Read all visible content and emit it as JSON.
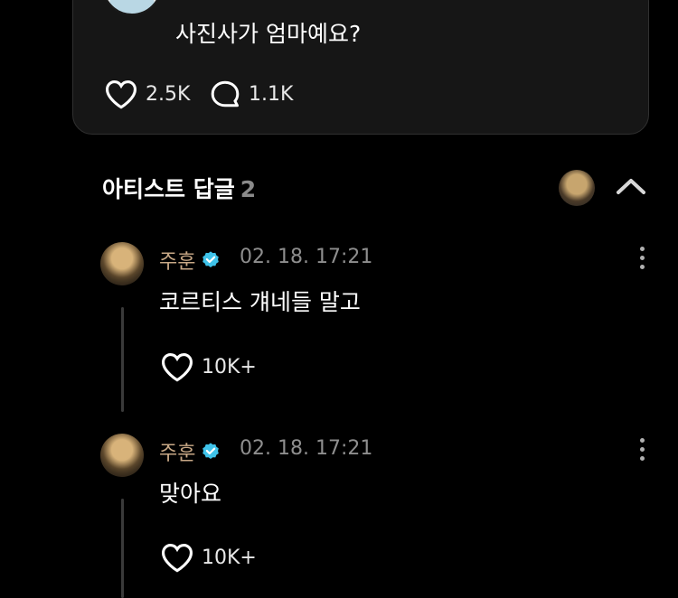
{
  "post": {
    "text": "사진사가 엄마예요?",
    "likes": "2.5K",
    "comments": "1.1K"
  },
  "artist_replies": {
    "title": "아티스트 답글",
    "count": "2"
  },
  "comments": [
    {
      "author": "주훈",
      "timestamp": "02. 18. 17:21",
      "text": "코르티스 걔네들 말고",
      "likes": "10K+"
    },
    {
      "author": "주훈",
      "timestamp": "02. 18. 17:21",
      "text": "맞아요",
      "likes": "10K+"
    }
  ],
  "colors": {
    "background": "#000000",
    "card": "#161616",
    "author": "#c8a886",
    "verified": "#3fc3ea",
    "muted": "#8e8e8e"
  }
}
